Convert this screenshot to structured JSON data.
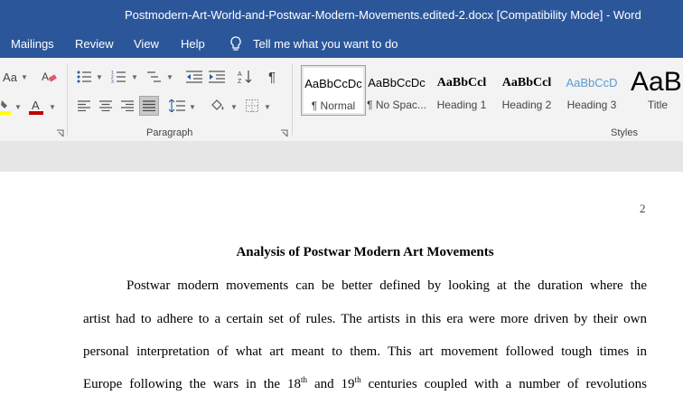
{
  "window": {
    "title": "Postmodern-Art-World-and-Postwar-Modern-Movements.edited-2.docx [Compatibility Mode]  -  Word"
  },
  "menu": {
    "items": [
      "Mailings",
      "Review",
      "View",
      "Help"
    ],
    "tell_me": "Tell me what you want to do"
  },
  "ribbon": {
    "font_partial": "Aa",
    "paragraph_group_label": "Paragraph",
    "styles_group_label": "Styles",
    "styles": [
      {
        "sample": "AaBbCcDc",
        "name": "¶ Normal"
      },
      {
        "sample": "AaBbCcDc",
        "name": "¶ No Spac..."
      },
      {
        "sample": "AaBbCcl",
        "name": "Heading 1"
      },
      {
        "sample": "AaBbCcl",
        "name": "Heading 2"
      },
      {
        "sample": "AaBbCcD",
        "name": "Heading 3"
      },
      {
        "sample": "AaB",
        "name": "Title"
      }
    ],
    "colors": {
      "font_color": "#c00000",
      "highlight": "#ffff00",
      "heading3_sample": "#5b9bd5",
      "title_bar": "#2b579a"
    }
  },
  "document": {
    "page_number": "2",
    "heading": "Analysis of Postwar Modern Art Movements",
    "lines": [
      "Postwar modern movements can be better defined by looking at the duration where the",
      "artist had to adhere to a certain set of rules. The artists in this era were more driven by their own",
      "personal interpretation of what art meant to them. This art movement followed tough times in"
    ],
    "line4": {
      "a": "Europe following the wars in the 18",
      "sup1": "th",
      "b": " and 19",
      "sup2": "th",
      "c": " centuries coupled with a number of revolutions"
    }
  }
}
